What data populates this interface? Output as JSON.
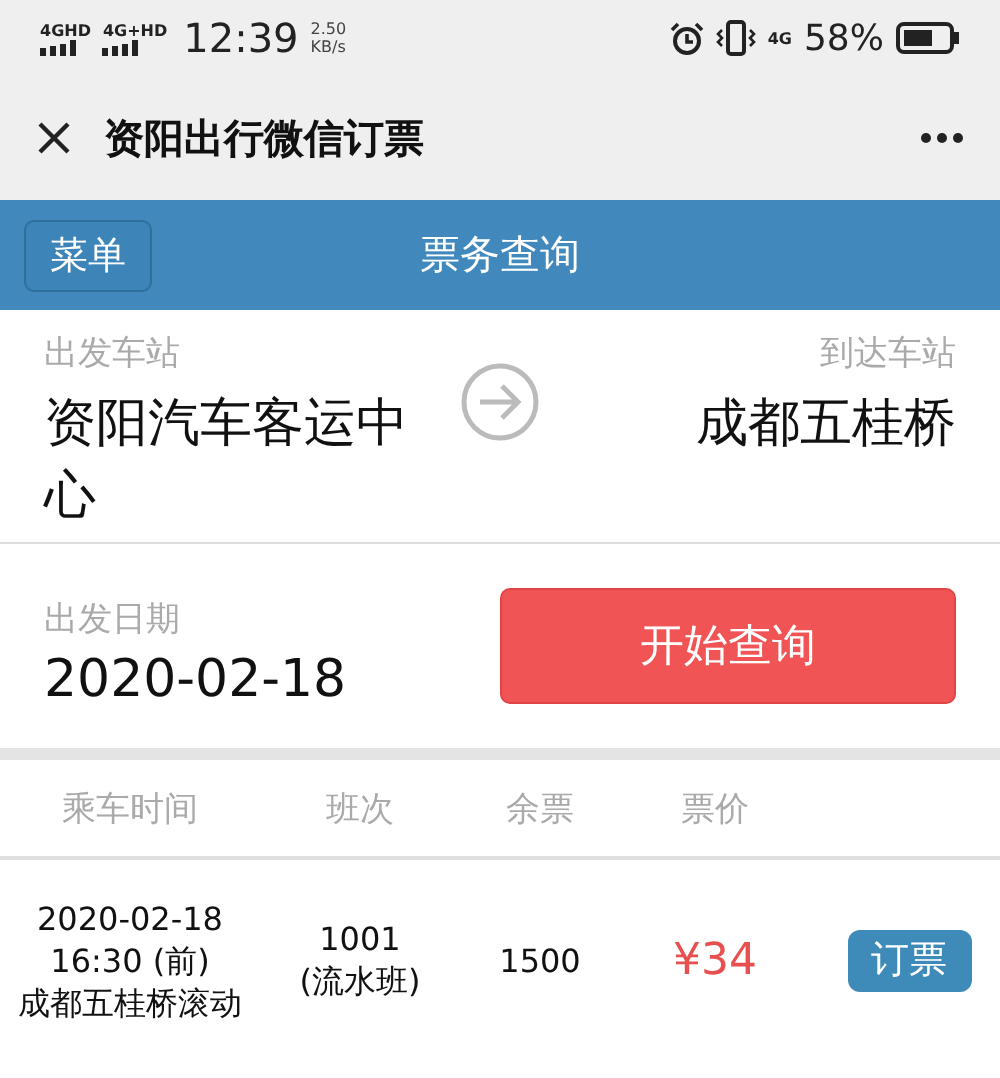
{
  "status_bar": {
    "networks": [
      "4GHD",
      "4G+HD"
    ],
    "time": "12:39",
    "speed": "2.50",
    "speed_unit": "KB/s",
    "network_right": "4G",
    "battery": "58%"
  },
  "title_bar": {
    "title": "资阳出行微信订票"
  },
  "header": {
    "menu_button": "菜单",
    "title": "票务查询"
  },
  "stations": {
    "from_label": "出发车站",
    "from": "资阳汽车客运中心",
    "to_label": "到达车站",
    "to": "成都五桂桥"
  },
  "date": {
    "label": "出发日期",
    "value": "2020-02-18",
    "search_button": "开始查询"
  },
  "table": {
    "columns": [
      "乘车时间",
      "班次",
      "余票",
      "票价"
    ],
    "rows": [
      {
        "date": "2020-02-18",
        "time": "16:30 (前)",
        "route": "成都五桂桥滚动",
        "number": "1001",
        "type": "(流水班)",
        "remaining": "1500",
        "price": "¥34",
        "action": "订票"
      }
    ]
  }
}
